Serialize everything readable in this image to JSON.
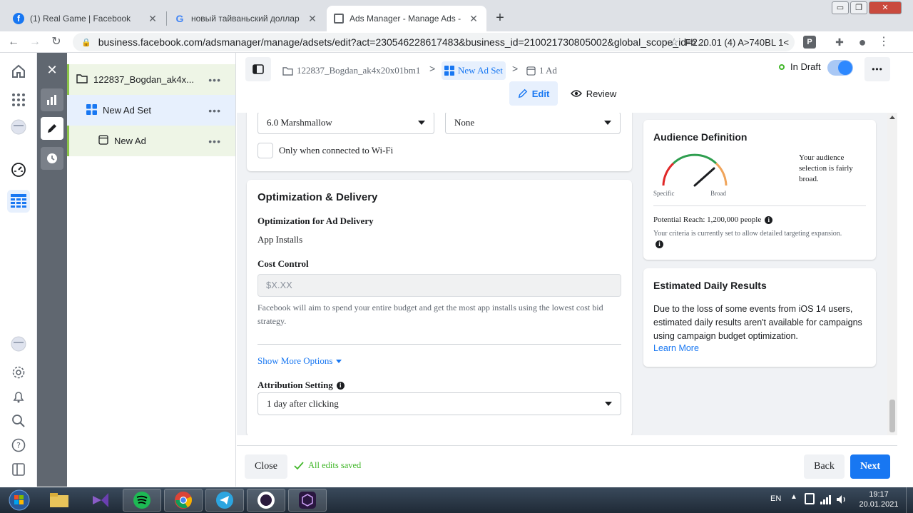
{
  "browser": {
    "tabs": [
      {
        "title": "(1) Real Game | Facebook",
        "icon": "facebook-icon",
        "active": false
      },
      {
        "title": "новый тайваньский доллар к до",
        "icon": "google-icon",
        "active": false
      },
      {
        "title": "Ads Manager - Manage Ads - Ad",
        "icon": "ads-manager-icon",
        "active": true
      }
    ],
    "new_tab": "+",
    "url": "business.facebook.com/adsmanager/manage/adsets/edit?act=230546228617483&business_id=210021730805002&global_scope_id=2...",
    "extension_text": "Fb 20.01 (4) A>740BL 1<",
    "window_controls": [
      "▭",
      "❐",
      "✕"
    ]
  },
  "tree": {
    "items": [
      {
        "label": "122837_Bogdan_ak4x...",
        "icon": "folder-icon",
        "more": "•••"
      },
      {
        "label": "New Ad Set",
        "icon": "adset-grid-icon",
        "more": "•••"
      },
      {
        "label": "New Ad",
        "icon": "ad-icon",
        "more": "•••"
      }
    ]
  },
  "header": {
    "breadcrumb": {
      "campaign": "122837_Bogdan_ak4x20x01bm1",
      "adset": "New Ad Set",
      "ad": "1 Ad",
      "separator": ">"
    },
    "status": "In Draft",
    "more": "•••",
    "modes": {
      "edit": "Edit",
      "review": "Review"
    }
  },
  "form": {
    "os_version": "6.0 Marshmallow",
    "max_os_version": "None",
    "wifi_label": "Only when connected to Wi-Fi",
    "optimization": {
      "section_title": "Optimization & Delivery",
      "delivery_label": "Optimization for Ad Delivery",
      "delivery_value": "App Installs",
      "cost_control_label": "Cost Control",
      "cost_control_placeholder": "$X.XX",
      "cost_control_help": "Facebook will aim to spend your entire budget and get the most app installs using the lowest cost bid strategy.",
      "show_more": "Show More Options",
      "attribution_label": "Attribution Setting",
      "attribution_value": "1 day after clicking"
    }
  },
  "side": {
    "audience": {
      "title": "Audience Definition",
      "specific": "Specific",
      "broad": "Broad",
      "summary": "Your audience selection is fairly broad.",
      "reach": "Potential Reach: 1,200,000 people",
      "criteria": "Your criteria is currently set to allow detailed targeting expansion."
    },
    "daily": {
      "title": "Estimated Daily Results",
      "text": "Due to the loss of some events from iOS 14 users, estimated daily results aren't available for campaigns using campaign budget optimization.",
      "link": "Learn More"
    }
  },
  "footer": {
    "close": "Close",
    "saved": "All edits saved",
    "back": "Back",
    "next": "Next"
  },
  "taskbar": {
    "lang": "EN",
    "time": "19:17",
    "date": "20.01.2021"
  },
  "colors": {
    "accent": "#1877f2",
    "toggle": "#2d88ff",
    "draft_dot": "#42b72a",
    "gauge_red": "#e02828",
    "gauge_green": "#2e9e4f",
    "gauge_orange": "#f0a45a"
  }
}
